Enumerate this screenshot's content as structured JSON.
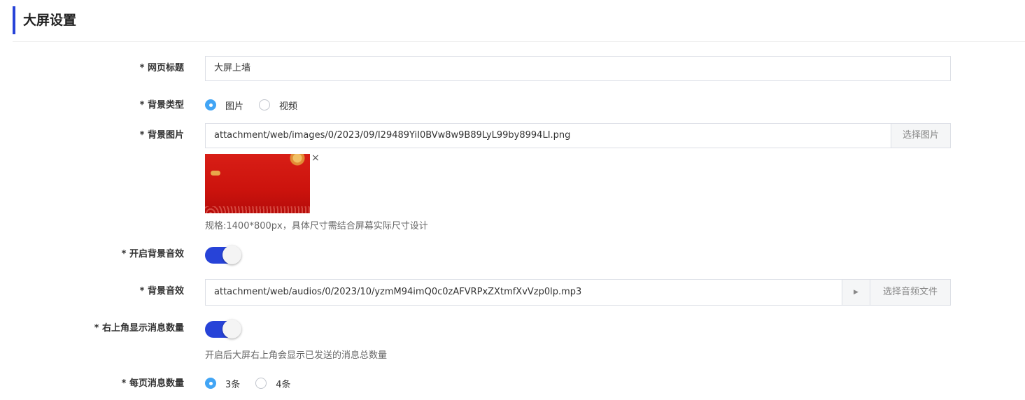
{
  "section": {
    "title": "大屏设置"
  },
  "fields": {
    "page_title": {
      "label": "* 网页标题",
      "value": "大屏上墙"
    },
    "bg_type": {
      "label": "* 背景类型",
      "options": [
        {
          "label": "图片",
          "checked": true
        },
        {
          "label": "视频",
          "checked": false
        }
      ]
    },
    "bg_image": {
      "label": "* 背景图片",
      "value": "attachment/web/images/0/2023/09/I29489YiI0BVw8w9B89LyL99by8994LI.png",
      "button": "选择图片",
      "remove": "×",
      "hint": "规格:1400*800px，具体尺寸需结合屏幕实际尺寸设计"
    },
    "bg_sound_enabled": {
      "label": "* 开启背景音效",
      "on": true
    },
    "bg_sound": {
      "label": "* 背景音效",
      "value": "attachment/web/audios/0/2023/10/yzmM94imQ0c0zAFVRPxZXtmfXvVzp0lp.mp3",
      "play": "▶",
      "button": "选择音频文件"
    },
    "msg_count_display": {
      "label": "* 右上角显示消息数量",
      "on": true,
      "hint": "开启后大屏右上角会显示已发送的消息总数量"
    },
    "per_page": {
      "label": "* 每页消息数量",
      "options": [
        {
          "label": "3条",
          "checked": true
        },
        {
          "label": "4条",
          "checked": false
        }
      ]
    }
  },
  "colors": {
    "accent": "#2743d8",
    "radio_on": "#42a5f5",
    "border": "#dcdfe6"
  }
}
